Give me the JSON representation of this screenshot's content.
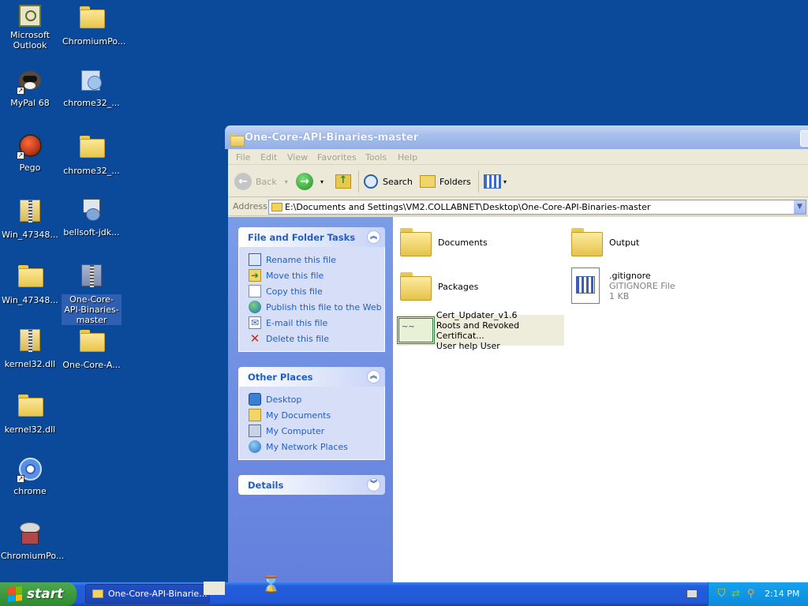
{
  "desktop": {
    "icons": [
      {
        "label": "Microsoft Outlook",
        "icon": "outlook-icon"
      },
      {
        "label": "ChromiumPo...",
        "icon": "folder-icon"
      },
      {
        "label": "MyPal 68",
        "icon": "raccoon-icon"
      },
      {
        "label": "chrome32_...",
        "icon": "installer-icon"
      },
      {
        "label": "Pego",
        "icon": "pego-icon"
      },
      {
        "label": "chrome32_...",
        "icon": "folder-icon"
      },
      {
        "label": "Win_47348...",
        "icon": "zip-icon"
      },
      {
        "label": "bellsoft-jdk...",
        "icon": "installer-icon"
      },
      {
        "label": "Win_47348...",
        "icon": "folder-icon"
      },
      {
        "label": "One-Core-API-Binaries-master",
        "icon": "zip-icon"
      },
      {
        "label": "kernel32.dll",
        "icon": "zip-icon"
      },
      {
        "label": "One-Core-A...",
        "icon": "folder-icon"
      },
      {
        "label": "kernel32.dll",
        "icon": "folder-icon"
      },
      {
        "label": "chrome",
        "icon": "chrome-icon"
      },
      {
        "label": "ChromiumPo...",
        "icon": "chromium-portable-icon"
      }
    ]
  },
  "window": {
    "title": "One-Core-API-Binaries-master",
    "menu": [
      "File",
      "Edit",
      "View",
      "Favorites",
      "Tools",
      "Help"
    ],
    "toolbar": {
      "back": "Back",
      "search": "Search",
      "folders": "Folders"
    },
    "address": {
      "label": "Address",
      "value": "E:\\Documents and Settings\\VM2.COLLABNET\\Desktop\\One-Core-API-Binaries-master"
    },
    "file_tasks": {
      "title": "File and Folder Tasks",
      "items": [
        {
          "label": "Rename this file",
          "icon": "rename-icon"
        },
        {
          "label": "Move this file",
          "icon": "move-icon"
        },
        {
          "label": "Copy this file",
          "icon": "copy-icon"
        },
        {
          "label": "Publish this file to the Web",
          "icon": "globe-icon"
        },
        {
          "label": "E-mail this file",
          "icon": "email-icon"
        },
        {
          "label": "Delete this file",
          "icon": "delete-icon"
        }
      ]
    },
    "other_places": {
      "title": "Other Places",
      "items": [
        {
          "label": "Desktop",
          "icon": "desktop-icon"
        },
        {
          "label": "My Documents",
          "icon": "my-documents-icon"
        },
        {
          "label": "My Computer",
          "icon": "my-computer-icon"
        },
        {
          "label": "My Network Places",
          "icon": "network-icon"
        }
      ]
    },
    "details": {
      "title": "Details"
    },
    "files": [
      {
        "name": "Documents",
        "type": "folder"
      },
      {
        "name": "Output",
        "type": "folder"
      },
      {
        "name": "Packages",
        "type": "folder"
      },
      {
        "name": ".gitignore",
        "sub1": "GITIGNORE File",
        "sub2": "1 KB"
      },
      {
        "name": "Cert_Updater_v1.6",
        "sub1": "Roots and Revoked Certificat...",
        "sub2": "User help User"
      }
    ]
  },
  "taskbar": {
    "start": "start",
    "active_task": "One-Core-API-Binarie...",
    "clock": "2:14 PM"
  },
  "colors": {
    "desktop": "#0b4a9b",
    "taskpane": "#6f8ee2",
    "taskbar": "#245edc",
    "start": "#3c9a3c",
    "link": "#215dc6"
  }
}
